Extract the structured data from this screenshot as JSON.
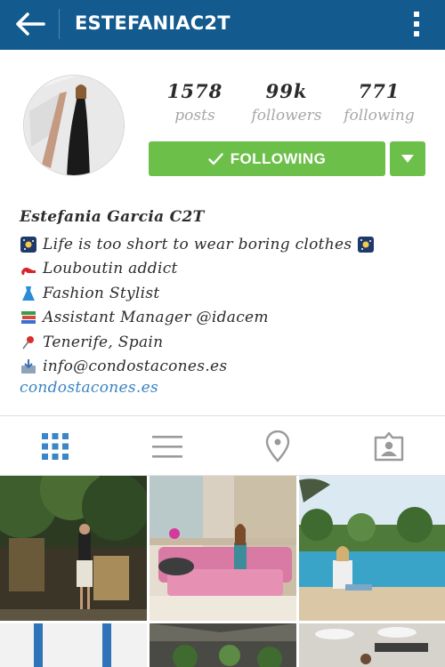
{
  "header": {
    "username": "ESTEFANIAC2T",
    "back_icon": "arrow-left-icon",
    "menu_icon": "more-vertical-icon",
    "bar_color": "#135a8e"
  },
  "profile": {
    "stats": [
      {
        "value": "1578",
        "label": "posts"
      },
      {
        "value": "99k",
        "label": "followers"
      },
      {
        "value": "771",
        "label": "following"
      }
    ],
    "follow_button_label": "FOLLOWING",
    "follow_button_color": "#6cc04a"
  },
  "bio": {
    "name": "Estefania Garcia C2T",
    "lines": [
      "Life is too short to wear boring clothes",
      "Louboutin addict",
      "Fashion Stylist",
      "Assistant Manager @idacem",
      "Tenerife, Spain",
      "info@condostacones.es"
    ],
    "website": "condostacones.es",
    "link_color": "#3a83c3"
  },
  "tabs": [
    {
      "name": "grid-view",
      "icon": "grid-icon",
      "active": true
    },
    {
      "name": "list-view",
      "icon": "list-icon",
      "active": false
    },
    {
      "name": "photo-map",
      "icon": "location-pin-icon",
      "active": false
    },
    {
      "name": "tagged-photos",
      "icon": "person-tag-icon",
      "active": false
    }
  ]
}
